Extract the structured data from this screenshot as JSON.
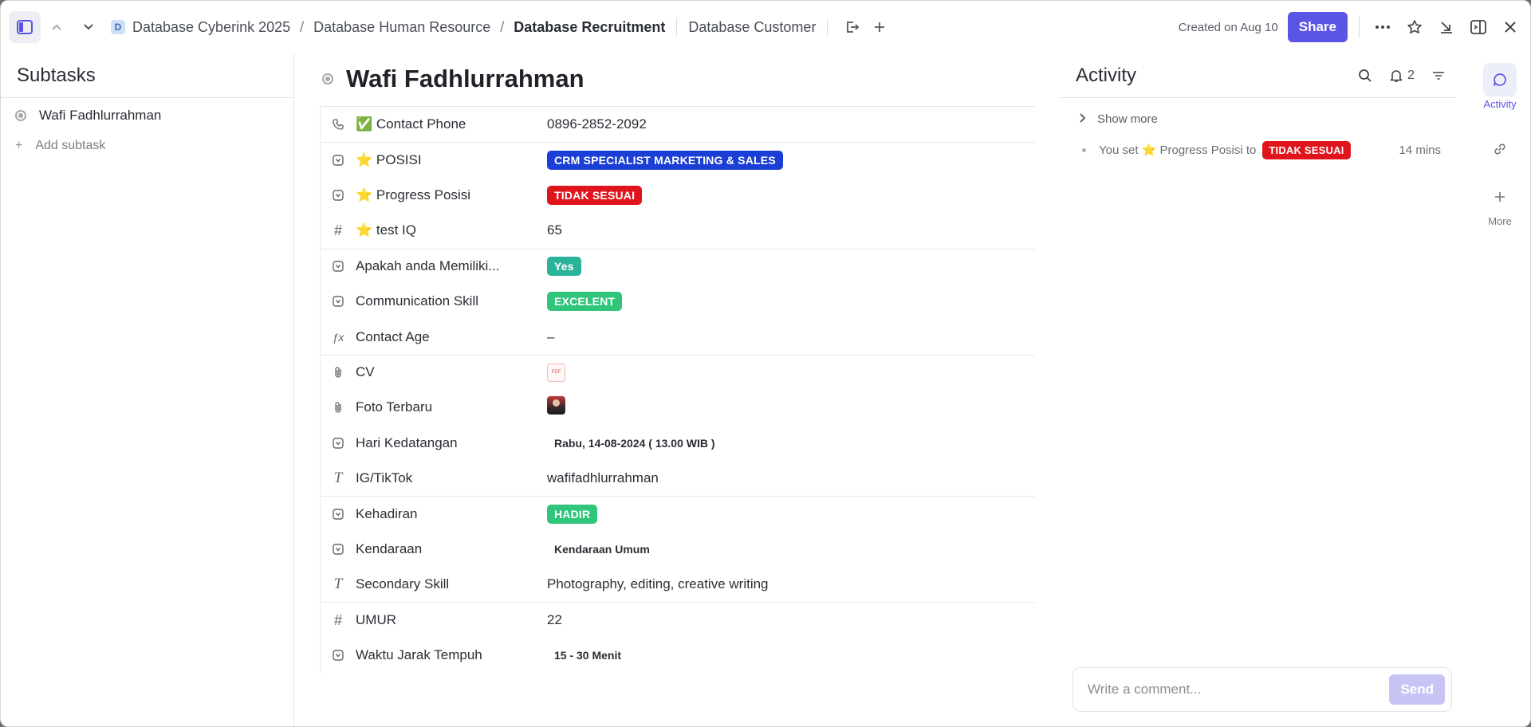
{
  "breadcrumb": {
    "badge": "D",
    "items": [
      "Database Cyberink 2025",
      "Database Human Resource",
      "Database Recruitment"
    ],
    "extra": "Database Customer"
  },
  "header": {
    "created": "Created on Aug 10",
    "share_label": "Share"
  },
  "subtasks": {
    "title": "Subtasks",
    "items": [
      "Wafi Fadhlurrahman"
    ],
    "add_label": "Add subtask"
  },
  "task": {
    "title": "Wafi Fadhlurrahman",
    "fields": [
      {
        "icon": "phone-icon",
        "label": "✅ Contact Phone",
        "value": "0896-2852-2092"
      },
      {
        "icon": "dropdown-icon",
        "label": "⭐ POSISI",
        "value": "CRM SPECIALIST MARKETING & SALES",
        "pill": "blue"
      },
      {
        "icon": "dropdown-icon",
        "label": "⭐ Progress Posisi",
        "value": "TIDAK SESUAI",
        "pill": "red"
      },
      {
        "icon": "number-icon",
        "label": "⭐ test IQ",
        "value": "65"
      },
      {
        "icon": "dropdown-icon",
        "label": "Apakah anda Memiliki...",
        "value": "Yes",
        "pill": "teal"
      },
      {
        "icon": "dropdown-icon",
        "label": "Communication Skill",
        "value": "EXCELENT",
        "pill": "green"
      },
      {
        "icon": "formula-icon",
        "label": "Contact Age",
        "value": "–"
      },
      {
        "icon": "attachment-icon",
        "label": "CV",
        "value": "PDF"
      },
      {
        "icon": "attachment-icon",
        "label": "Foto Terbaru",
        "value": ""
      },
      {
        "icon": "dropdown-icon",
        "label": "Hari Kedatangan",
        "value": "Rabu, 14-08-2024 ( 13.00 WIB )"
      },
      {
        "icon": "text-icon",
        "label": "IG/TikTok",
        "value": "wafifadhlurrahman"
      },
      {
        "icon": "dropdown-icon",
        "label": "Kehadiran",
        "value": "HADIR",
        "pill": "green"
      },
      {
        "icon": "dropdown-icon",
        "label": "Kendaraan",
        "value": "Kendaraan Umum"
      },
      {
        "icon": "text-icon",
        "label": "Secondary Skill",
        "value": "Photography, editing, creative writing"
      },
      {
        "icon": "number-icon",
        "label": "UMUR",
        "value": "22"
      },
      {
        "icon": "dropdown-icon",
        "label": "Waktu Jarak Tempuh",
        "value": "15 - 30 Menit"
      }
    ]
  },
  "activity": {
    "title": "Activity",
    "notif_count": "2",
    "show_more": "Show more",
    "item": {
      "prefix": "You set ⭐ Progress Posisi to",
      "pill": "TIDAK SESUAI",
      "time": "14 mins"
    },
    "comment_placeholder": "Write a comment...",
    "send_label": "Send"
  },
  "rail": {
    "activity_label": "Activity",
    "more_label": "More"
  },
  "colors": {
    "accent": "#5b55e6",
    "pill_blue": "#1b3fd6",
    "pill_red": "#e0141c",
    "pill_teal": "#2bb39a",
    "pill_green": "#2fc57a"
  }
}
